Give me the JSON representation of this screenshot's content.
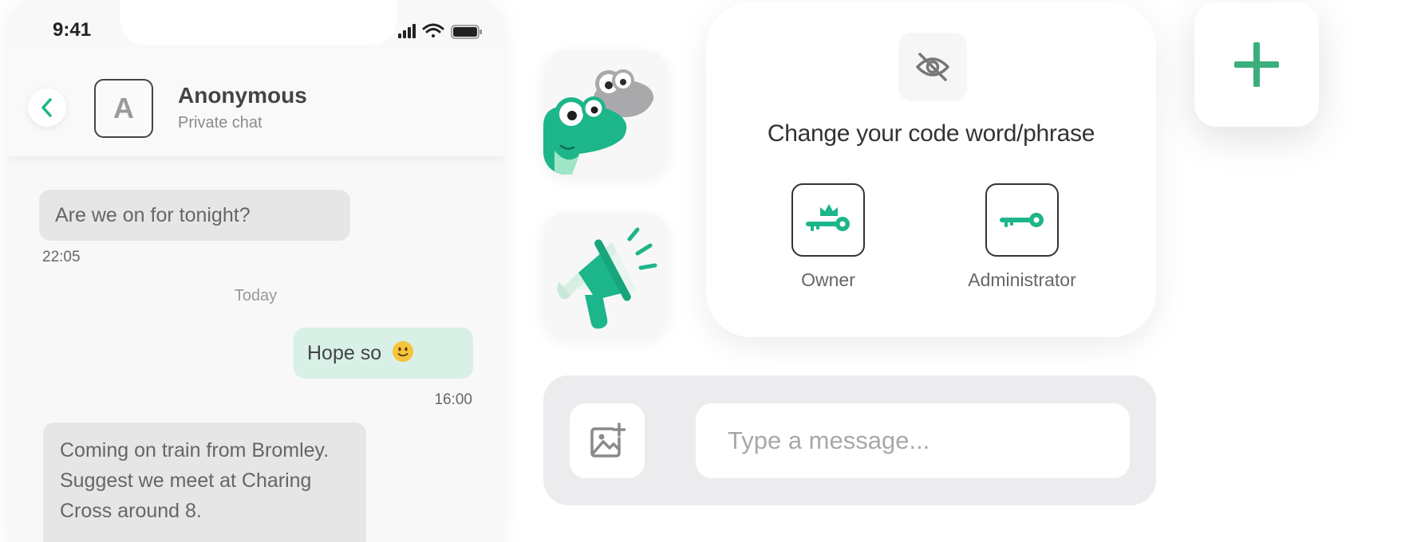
{
  "status_bar": {
    "time": "9:41"
  },
  "chat": {
    "avatar_letter": "A",
    "name": "Anonymous",
    "subtitle": "Private chat",
    "messages": [
      {
        "text": "Are we on for tonight?",
        "direction": "incoming",
        "time": "22:05"
      },
      {
        "text": "Hope so",
        "direction": "outgoing",
        "time": "16:00",
        "emoji": "slightly-smiling-face-icon"
      },
      {
        "text": "Coming on train from Bromley. Suggest we meet at Charing Cross around 8.",
        "direction": "incoming"
      }
    ],
    "day_separator": "Today"
  },
  "code_card": {
    "title": "Change your code word/phrase",
    "roles": [
      {
        "label": "Owner",
        "icon": "crowned-key-icon"
      },
      {
        "label": "Administrator",
        "icon": "key-icon"
      }
    ]
  },
  "composer": {
    "placeholder": "Type a message..."
  },
  "colors": {
    "accent": "#1db58a",
    "plus": "#3aae7c",
    "incoming_bubble": "#e6e6e6",
    "outgoing_bubble": "#d8f0e6"
  }
}
